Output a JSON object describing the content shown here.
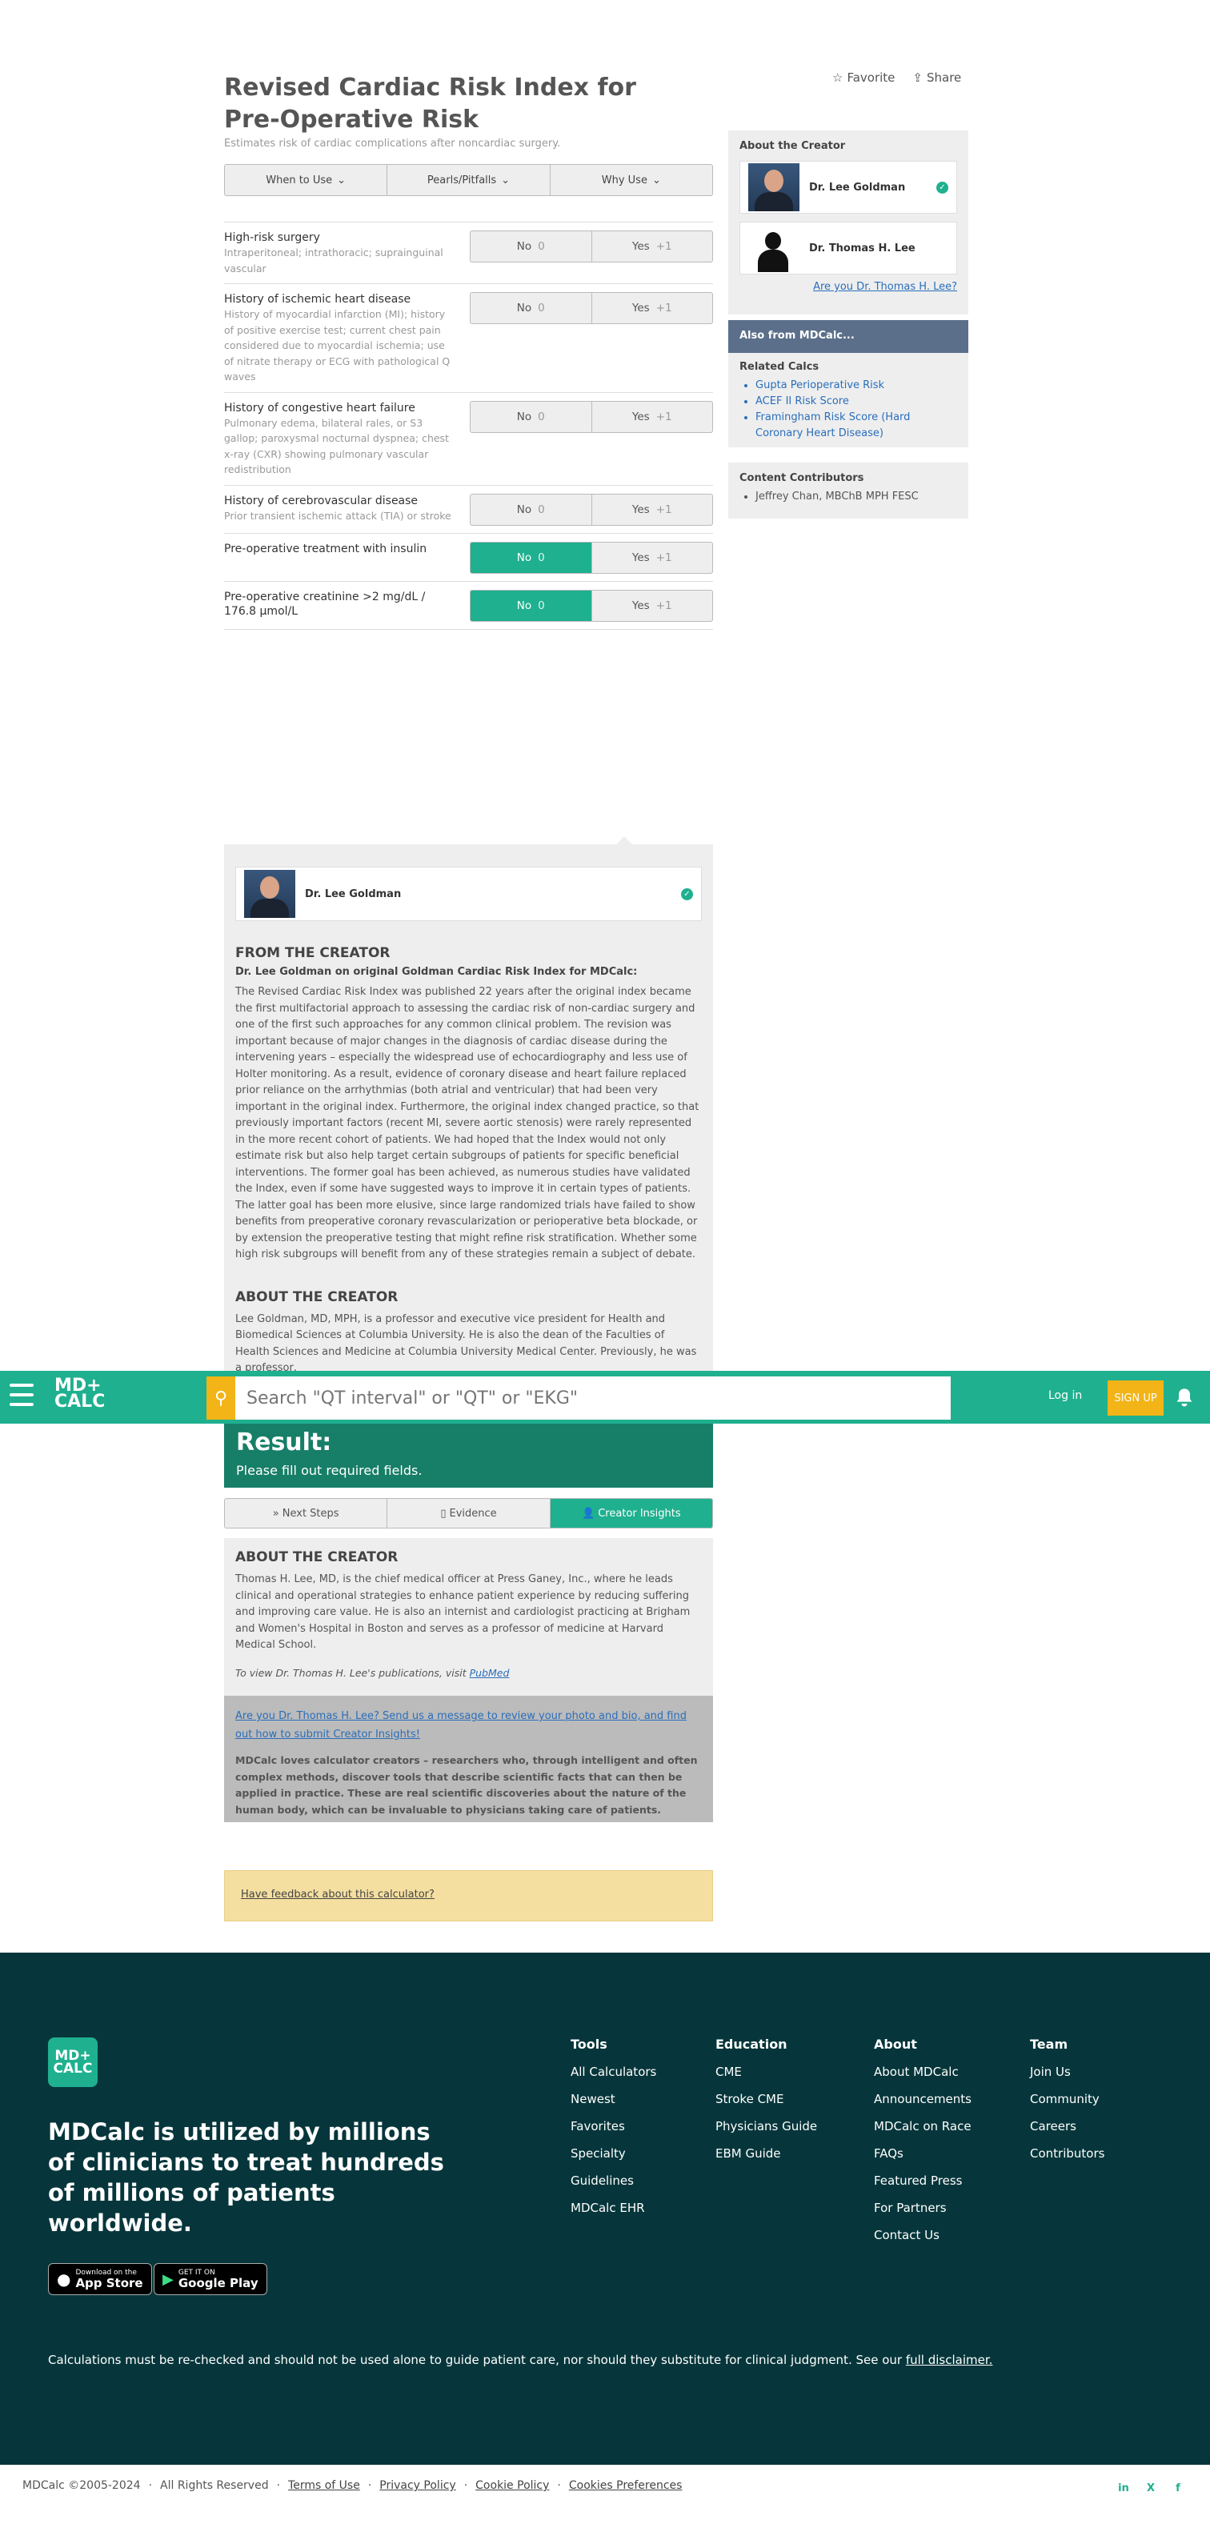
{
  "page": {
    "title": "Revised Cardiac Risk Index for Pre-Operative Risk",
    "subtitle": "Estimates risk of cardiac complications after noncardiac surgery.",
    "favorite": "Favorite",
    "share": "Share"
  },
  "info_tabs": [
    "When to Use",
    "Pearls/Pitfalls",
    "Why Use"
  ],
  "criteria": [
    {
      "title": "High-risk surgery",
      "detail": "Intraperitoneal; intrathoracic; suprainguinal vascular",
      "no": "No",
      "no_pts": "0",
      "yes": "Yes",
      "yes_pts": "+1",
      "selected": ""
    },
    {
      "title": "History of ischemic heart disease",
      "detail": "History of myocardial infarction (MI); history of positive exercise test; current chest pain considered due to myocardial ischemia; use of nitrate therapy or ECG with pathological Q waves",
      "no": "No",
      "no_pts": "0",
      "yes": "Yes",
      "yes_pts": "+1",
      "selected": ""
    },
    {
      "title": "History of congestive heart failure",
      "detail": "Pulmonary edema, bilateral rales, or S3 gallop; paroxysmal nocturnal dyspnea; chest x-ray (CXR) showing pulmonary vascular redistribution",
      "no": "No",
      "no_pts": "0",
      "yes": "Yes",
      "yes_pts": "+1",
      "selected": ""
    },
    {
      "title": "History of cerebrovascular disease",
      "detail": "Prior transient ischemic attack (TIA) or stroke",
      "no": "No",
      "no_pts": "0",
      "yes": "Yes",
      "yes_pts": "+1",
      "selected": ""
    },
    {
      "title": "Pre-operative treatment with insulin",
      "detail": "",
      "no": "No",
      "no_pts": "0",
      "yes": "Yes",
      "yes_pts": "+1",
      "selected": "no"
    },
    {
      "title": "Pre-operative creatinine >2 mg/dL / 176.8 µmol/L",
      "detail": "",
      "no": "No",
      "no_pts": "0",
      "yes": "Yes",
      "yes_pts": "+1",
      "selected": "no"
    }
  ],
  "sidebar": {
    "about_heading": "About the Creator",
    "creator1": "Dr. Lee Goldman",
    "creator2": "Dr. Thomas H. Lee",
    "are_you": "Are you Dr. Thomas H. Lee?",
    "also_from": "Also from MDCalc...",
    "related_heading": "Related Calcs",
    "related": [
      "Gupta Perioperative Risk",
      "ACEF II Risk Score",
      "Framingham Risk Score (Hard Coronary Heart Disease)"
    ],
    "contrib_heading": "Content Contributors",
    "contributors": [
      "Jeffrey Chan, MBChB MPH FESC"
    ]
  },
  "insight": {
    "creator": "Dr. Lee Goldman",
    "from_heading": "FROM THE CREATOR",
    "from_sub": "Dr. Lee Goldman on original Goldman Cardiac Risk Index for MDCalc:",
    "from_text": "The Revised Cardiac Risk Index was published 22 years after the original index became the first multifactorial approach to assessing the cardiac risk of non-cardiac surgery and one of the first such approaches for any common clinical problem. The revision was important because of major changes in the diagnosis of cardiac disease during the intervening years – especially the widespread use of echocardiography and less use of Holter monitoring. As a result, evidence of coronary disease and heart failure replaced prior reliance on the arrhythmias (both atrial and ventricular) that had been very important in the original index. Furthermore, the original index changed practice, so that previously important factors (recent MI, severe aortic stenosis) were rarely represented in the more recent cohort of patients. We had hoped that the Index would not only estimate risk but also help target certain subgroups of patients for specific beneficial interventions. The former goal has been achieved, as numerous studies have validated the Index, even if some have suggested ways to improve it in certain types of patients. The latter goal has been more elusive, since large randomized trials have failed to show benefits from preoperative coronary revascularization or perioperative beta blockade, or by extension the preoperative testing that might refine risk stratification. Whether some high risk subgroups will benefit from any of these strategies remain a subject of debate.",
    "about_heading": "ABOUT THE CREATOR",
    "about_text": "Lee Goldman, MD, MPH, is a professor and executive vice president for Health and Biomedical Sciences at Columbia University. He is also the dean of the Faculties of Health Sciences and Medicine at Columbia University Medical Center. Previously, he was a professor,"
  },
  "nav": {
    "logo_line1": "MD+",
    "logo_line2": "CALC",
    "search_placeholder": "Search \"QT interval\" or \"QT\" or \"EKG\"",
    "login": "Log in",
    "signup": "SIGN UP"
  },
  "result": {
    "heading": "Result:",
    "message": "Please fill out required fields."
  },
  "result_tabs": [
    "Next Steps",
    "Evidence",
    "Creator Insights"
  ],
  "about2": {
    "heading": "ABOUT THE CREATOR",
    "text": "Thomas H. Lee, MD, is the chief medical officer at Press Ganey, Inc., where he leads clinical and operational strategies to enhance patient experience by reducing suffering and improving care value. He is also an internist and cardiologist practicing at Brigham and Women's Hospital in Boston and serves as a professor of medicine at Harvard Medical School.",
    "pub_prefix": "To view Dr. Thomas H. Lee's publications, visit ",
    "pub_link": "PubMed"
  },
  "grey_box": {
    "link": "Are you Dr. Thomas H. Lee? Send us a message to review your photo and bio, and find out how to submit Creator Insights!",
    "text": "MDCalc loves calculator creators – researchers who, through intelligent and often complex methods, discover tools that describe scientific facts that can then be applied in practice. These are real scientific discoveries about the nature of the human body, which can be invaluable to physicians taking care of patients."
  },
  "feedback": "Have feedback about this calculator?",
  "footer": {
    "logo_line1": "MD+",
    "logo_line2": "CALC",
    "tagline": "MDCalc is utilized by millions of clinicians to treat hundreds of millions of patients worldwide.",
    "appstore_small": "Download on the",
    "appstore_big": "App Store",
    "google_small": "GET IT ON",
    "google_big": "Google Play",
    "columns": [
      {
        "heading": "Tools",
        "items": [
          "All Calculators",
          "Newest",
          "Favorites",
          "Specialty",
          "Guidelines",
          "MDCalc EHR"
        ]
      },
      {
        "heading": "Education",
        "items": [
          "CME",
          "Stroke CME",
          "Physicians Guide",
          "EBM Guide"
        ]
      },
      {
        "heading": "About",
        "items": [
          "About MDCalc",
          "Announcements",
          "MDCalc on Race",
          "FAQs",
          "Featured Press",
          "For Partners",
          "Contact Us"
        ]
      },
      {
        "heading": "Team",
        "items": [
          "Join Us",
          "Community",
          "Careers",
          "Contributors"
        ]
      }
    ],
    "disclaimer_prefix": "Calculations must be re-checked and should not be used alone to guide patient care, nor should they substitute for clinical judgment. See our ",
    "disclaimer_link": "full disclaimer.",
    "copyright": "MDCalc ©2005-2024",
    "rights": "All Rights Reserved",
    "legal_links": [
      "Terms of Use",
      "Privacy Policy",
      "Cookie Policy",
      "Cookies Preferences"
    ],
    "social": [
      "in",
      "X",
      "f"
    ]
  }
}
